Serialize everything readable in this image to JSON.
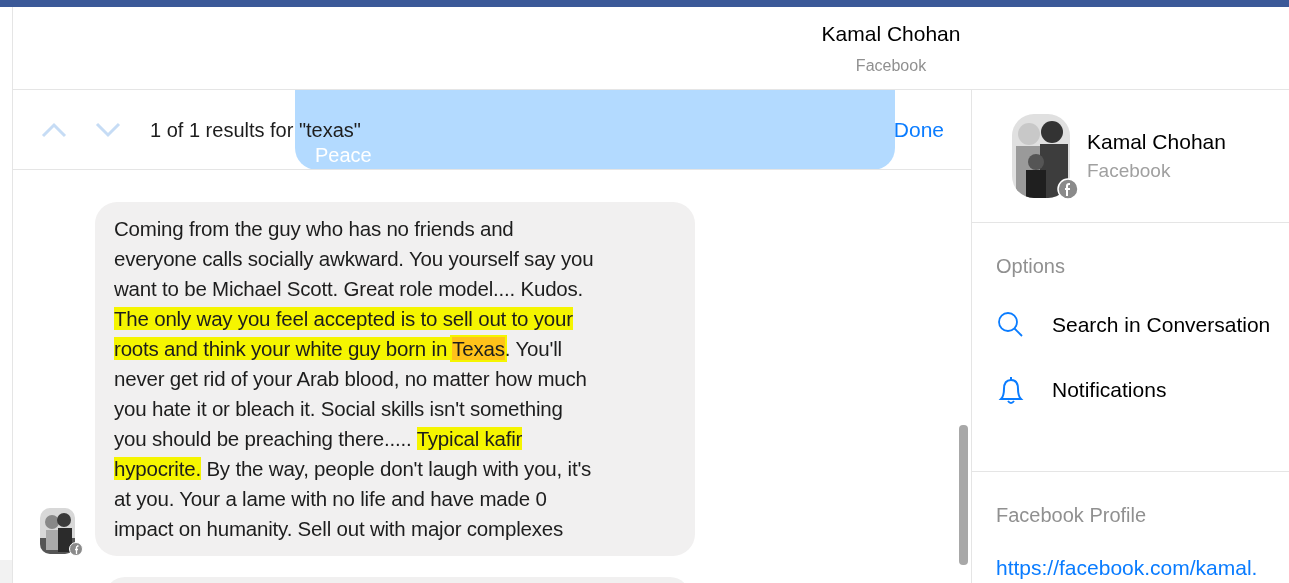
{
  "header": {
    "title": "Kamal Chohan",
    "subtitle": "Facebook"
  },
  "search_bar": {
    "result_text": "1 of 1 results for \"texas\"",
    "done": "Done"
  },
  "hidden_bubble": {
    "text": "Peace"
  },
  "message": {
    "lines": [
      [
        {
          "text": "Coming from the guy who has no friends and",
          "highlighted": false,
          "search_match": false
        }
      ],
      [
        {
          "text": "everyone calls socially awkward. You yourself say you",
          "highlighted": false,
          "search_match": false
        }
      ],
      [
        {
          "text": "want to be Michael Scott. Great role model.... Kudos.",
          "highlighted": false,
          "search_match": false
        }
      ],
      [
        {
          "text": "The only way you feel accepted is to sell out to your",
          "highlighted": true,
          "search_match": false
        }
      ],
      [
        {
          "text": "roots and think your white guy born in ",
          "highlighted": true,
          "search_match": false
        },
        {
          "text": "Texas",
          "highlighted": true,
          "search_match": true
        },
        {
          "text": ". You'll",
          "highlighted": false,
          "search_match": false
        }
      ],
      [
        {
          "text": "never get rid of your Arab blood, no matter how much",
          "highlighted": false,
          "search_match": false
        }
      ],
      [
        {
          "text": "you hate it or bleach it. Social skills isn't something",
          "highlighted": false,
          "search_match": false
        }
      ],
      [
        {
          "text": "you should be preaching there..... ",
          "highlighted": false,
          "search_match": false
        },
        {
          "text": "Typical kafir",
          "highlighted": true,
          "search_match": false
        }
      ],
      [
        {
          "text": "hypocrite.",
          "highlighted": true,
          "search_match": false
        },
        {
          "text": " By the way, people don't laugh with you, it's",
          "highlighted": false,
          "search_match": false
        }
      ],
      [
        {
          "text": "at you. Your a lame  with no life and have made 0",
          "highlighted": false,
          "search_match": false
        }
      ],
      [
        {
          "text": "impact on humanity. Sell out with major complexes",
          "highlighted": false,
          "search_match": false
        }
      ]
    ]
  },
  "sidebar": {
    "name": "Kamal Chohan",
    "source": "Facebook",
    "options_heading": "Options",
    "options": [
      {
        "kind": "search",
        "label": "Search in Conversation"
      },
      {
        "kind": "bell",
        "label": "Notifications"
      }
    ],
    "profile_heading": "Facebook Profile",
    "profile_link": "https://facebook.com/kamal."
  }
}
